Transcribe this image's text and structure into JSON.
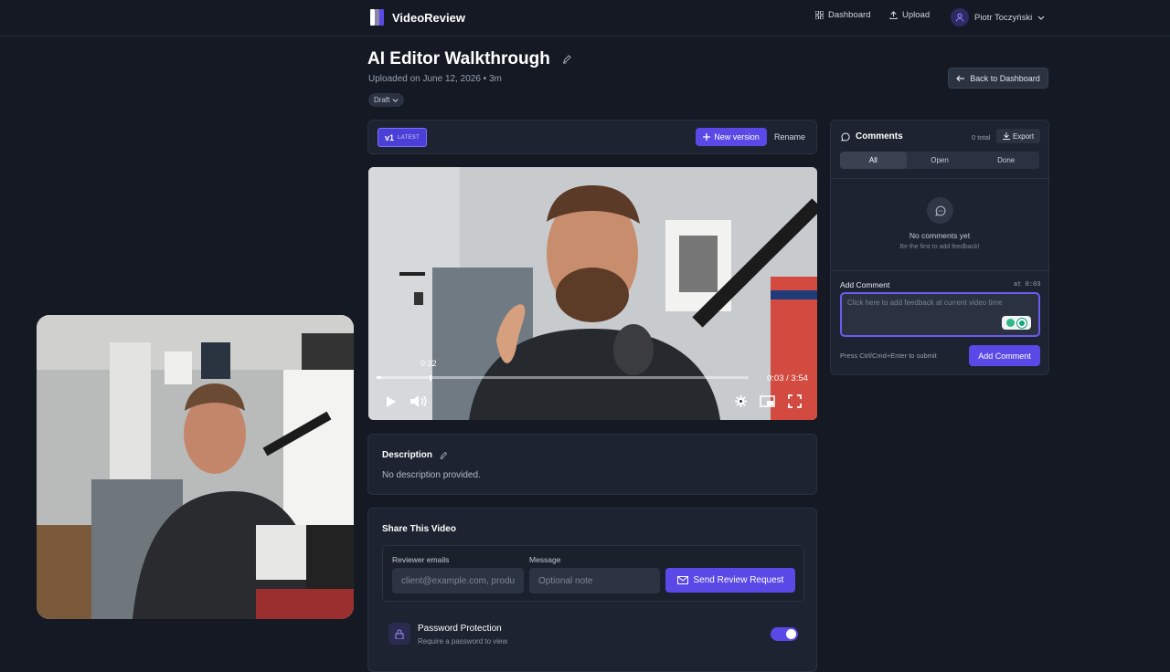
{
  "app": {
    "name": "VideoReview"
  },
  "nav": {
    "dashboard": "Dashboard",
    "upload": "Upload",
    "user_name": "Piotr Toczyński"
  },
  "video": {
    "title": "AI Editor Walkthrough",
    "uploaded": "Uploaded on June 12, 2026 • 3m",
    "status": "Draft",
    "back_label": "Back to Dashboard",
    "version": "v1",
    "version_tag": "LATEST",
    "new_version_label": "New version",
    "rename_label": "Rename",
    "player": {
      "hover_time": "0:32",
      "time_display": "0:03 / 3:54",
      "progress": 0.013
    }
  },
  "description": {
    "heading": "Description",
    "text": "No description provided."
  },
  "share": {
    "heading": "Share This Video",
    "emails_label": "Reviewer emails",
    "emails_placeholder": "client@example.com, produ",
    "message_label": "Message",
    "message_placeholder": "Optional note",
    "send_label": "Send Review Request",
    "password_title": "Password Protection",
    "password_sub": "Require a password to view",
    "password_enabled": true
  },
  "comments": {
    "heading": "Comments",
    "count": "0 total",
    "export_label": "Export",
    "tabs": [
      "All",
      "Open",
      "Done"
    ],
    "empty_title": "No comments yet",
    "empty_sub": "Be the first to add feedback!",
    "add_label": "Add Comment",
    "timestamp": "at 0:03",
    "placeholder": "Click here to add feedback at current video time",
    "hint": "Press Ctrl/Cmd+Enter to submit",
    "add_button": "Add Comment"
  },
  "colors": {
    "accent": "#5a49e6",
    "background": "#141923",
    "panel": "#1d2330"
  }
}
